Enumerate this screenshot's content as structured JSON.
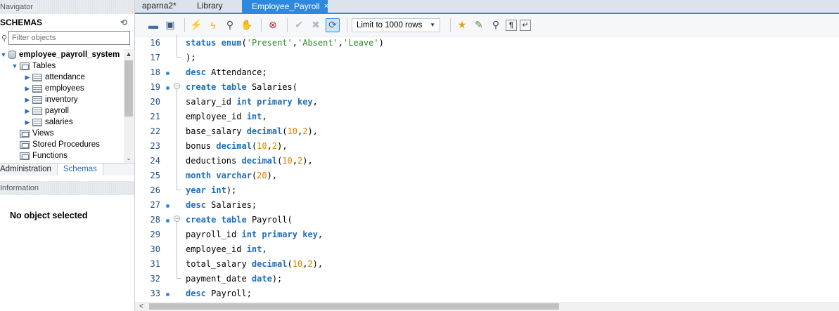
{
  "navigator": {
    "title": "Navigator",
    "schemas_label": "SCHEMAS",
    "filter_placeholder": "Filter objects",
    "schema_name": "employee_payroll_system",
    "tables_label": "Tables",
    "tables": [
      "attendance",
      "employees",
      "inventory",
      "payroll",
      "salaries"
    ],
    "views_label": "Views",
    "procedures_label": "Stored Procedures",
    "functions_label": "Functions",
    "tab_administration": "Administration",
    "tab_schemas": "Schemas",
    "information_title": "Information",
    "no_object": "No object selected"
  },
  "editor": {
    "tabs": [
      "aparna2*",
      "Library",
      "Employee_Payroll"
    ],
    "close_glyph": "×",
    "limit_label": "Limit to 1000 rows"
  },
  "code_lines": [
    {
      "n": "16",
      "dot": false,
      "fold": "line"
    },
    {
      "n": "17",
      "dot": false,
      "fold": "end"
    },
    {
      "n": "18",
      "dot": true,
      "fold": "none"
    },
    {
      "n": "19",
      "dot": true,
      "fold": "start"
    },
    {
      "n": "20",
      "dot": false,
      "fold": "line"
    },
    {
      "n": "21",
      "dot": false,
      "fold": "line"
    },
    {
      "n": "22",
      "dot": false,
      "fold": "line"
    },
    {
      "n": "23",
      "dot": false,
      "fold": "line"
    },
    {
      "n": "24",
      "dot": false,
      "fold": "line"
    },
    {
      "n": "25",
      "dot": false,
      "fold": "line"
    },
    {
      "n": "26",
      "dot": false,
      "fold": "end"
    },
    {
      "n": "27",
      "dot": true,
      "fold": "none"
    },
    {
      "n": "28",
      "dot": true,
      "fold": "start"
    },
    {
      "n": "29",
      "dot": false,
      "fold": "line"
    },
    {
      "n": "30",
      "dot": false,
      "fold": "line"
    },
    {
      "n": "31",
      "dot": false,
      "fold": "line"
    },
    {
      "n": "32",
      "dot": false,
      "fold": "end"
    },
    {
      "n": "33",
      "dot": true,
      "fold": "none"
    }
  ],
  "code_tokens": [
    [
      [
        "kw",
        "status"
      ],
      [
        "t",
        " "
      ],
      [
        "kw",
        "enum"
      ],
      [
        "t",
        "("
      ],
      [
        "str",
        "'Present'"
      ],
      [
        "t",
        ","
      ],
      [
        "str",
        "'Absent'"
      ],
      [
        "t",
        ","
      ],
      [
        "str",
        "'Leave'"
      ],
      [
        "t",
        ")"
      ]
    ],
    [
      [
        "t",
        ");"
      ]
    ],
    [
      [
        "kw",
        "desc"
      ],
      [
        "t",
        " Attendance;"
      ]
    ],
    [
      [
        "kw",
        "create"
      ],
      [
        "t",
        " "
      ],
      [
        "kw",
        "table"
      ],
      [
        "t",
        " Salaries("
      ]
    ],
    [
      [
        "t",
        "salary_id "
      ],
      [
        "kw",
        "int"
      ],
      [
        "t",
        " "
      ],
      [
        "kw",
        "primary"
      ],
      [
        "t",
        " "
      ],
      [
        "kw",
        "key"
      ],
      [
        "t",
        ","
      ]
    ],
    [
      [
        "t",
        "employee_id "
      ],
      [
        "kw",
        "int"
      ],
      [
        "t",
        ","
      ]
    ],
    [
      [
        "t",
        "base_salary "
      ],
      [
        "kw",
        "decimal"
      ],
      [
        "t",
        "("
      ],
      [
        "num",
        "10"
      ],
      [
        "t",
        ","
      ],
      [
        "num",
        "2"
      ],
      [
        "t",
        "),"
      ]
    ],
    [
      [
        "t",
        "bonus "
      ],
      [
        "kw",
        "decimal"
      ],
      [
        "t",
        "("
      ],
      [
        "num",
        "10"
      ],
      [
        "t",
        ","
      ],
      [
        "num",
        "2"
      ],
      [
        "t",
        "),"
      ]
    ],
    [
      [
        "t",
        "deductions "
      ],
      [
        "kw",
        "decimal"
      ],
      [
        "t",
        "("
      ],
      [
        "num",
        "10"
      ],
      [
        "t",
        ","
      ],
      [
        "num",
        "2"
      ],
      [
        "t",
        "),"
      ]
    ],
    [
      [
        "kw",
        "month"
      ],
      [
        "t",
        " "
      ],
      [
        "kw",
        "varchar"
      ],
      [
        "t",
        "("
      ],
      [
        "num",
        "20"
      ],
      [
        "t",
        "),"
      ]
    ],
    [
      [
        "kw",
        "year"
      ],
      [
        "t",
        " "
      ],
      [
        "kw",
        "int"
      ],
      [
        "t",
        ");"
      ]
    ],
    [
      [
        "kw",
        "desc"
      ],
      [
        "t",
        " Salaries;"
      ]
    ],
    [
      [
        "kw",
        "create"
      ],
      [
        "t",
        " "
      ],
      [
        "kw",
        "table"
      ],
      [
        "t",
        " Payroll("
      ]
    ],
    [
      [
        "t",
        "payroll_id "
      ],
      [
        "kw",
        "int"
      ],
      [
        "t",
        " "
      ],
      [
        "kw",
        "primary"
      ],
      [
        "t",
        " "
      ],
      [
        "kw",
        "key"
      ],
      [
        "t",
        ","
      ]
    ],
    [
      [
        "t",
        "employee_id "
      ],
      [
        "kw",
        "int"
      ],
      [
        "t",
        ","
      ]
    ],
    [
      [
        "t",
        "total_salary "
      ],
      [
        "kw",
        "decimal"
      ],
      [
        "t",
        "("
      ],
      [
        "num",
        "10"
      ],
      [
        "t",
        ","
      ],
      [
        "num",
        "2"
      ],
      [
        "t",
        "),"
      ]
    ],
    [
      [
        "t",
        "payment_date "
      ],
      [
        "kw",
        "date"
      ],
      [
        "t",
        ");"
      ]
    ],
    [
      [
        "kw",
        "desc"
      ],
      [
        "t",
        " Payroll;"
      ]
    ]
  ]
}
